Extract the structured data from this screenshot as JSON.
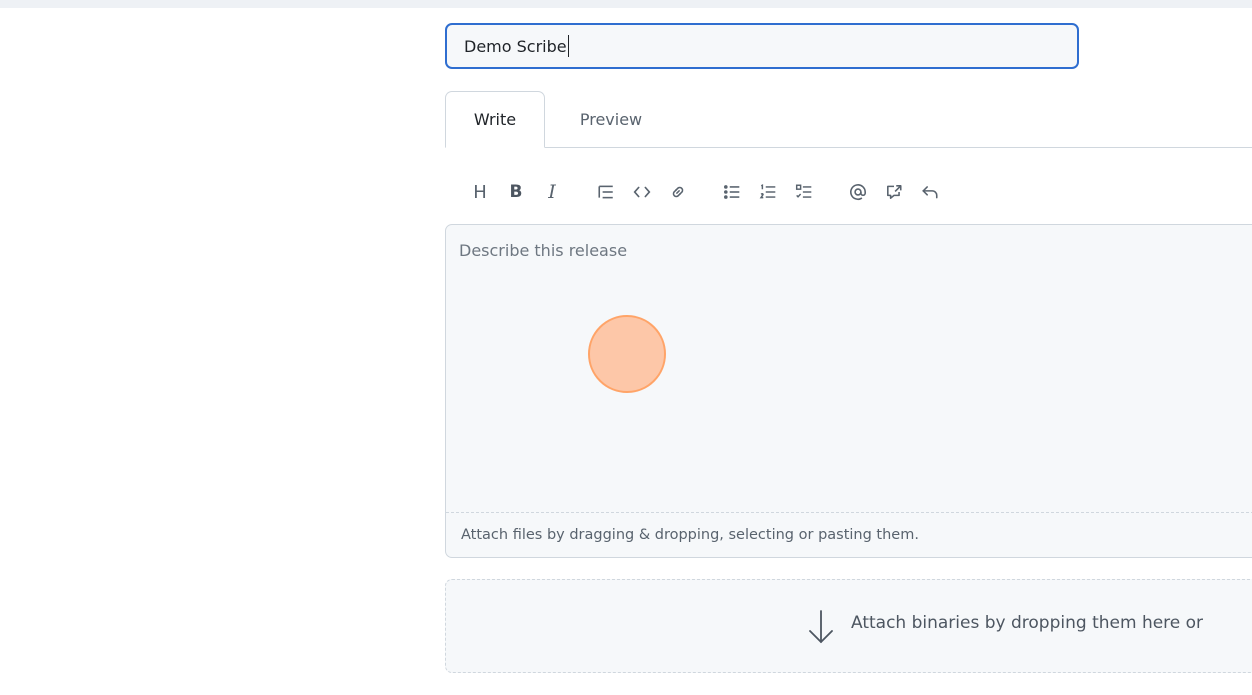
{
  "release": {
    "title_value": "Demo Scribe"
  },
  "tabs": [
    {
      "label": "Write",
      "active": true
    },
    {
      "label": "Preview",
      "active": false
    }
  ],
  "toolbar": {
    "heading": "H",
    "bold": "B",
    "italic": "I",
    "icons": [
      "heading-icon",
      "bold-icon",
      "italic-icon",
      "quote-icon",
      "code-icon",
      "link-icon",
      "unordered-list-icon",
      "ordered-list-icon",
      "task-list-icon",
      "mention-icon",
      "cross-reference-icon",
      "reply-icon"
    ]
  },
  "editor": {
    "placeholder": "Describe this release",
    "attach_hint": "Attach files by dragging & dropping, selecting or pasting them."
  },
  "binaries": {
    "drop_text": "Attach binaries by dropping them here or"
  },
  "colors": {
    "focus_border": "#2f6ed0",
    "cursor_highlight": "#ffa468",
    "muted_text": "#59636e"
  }
}
